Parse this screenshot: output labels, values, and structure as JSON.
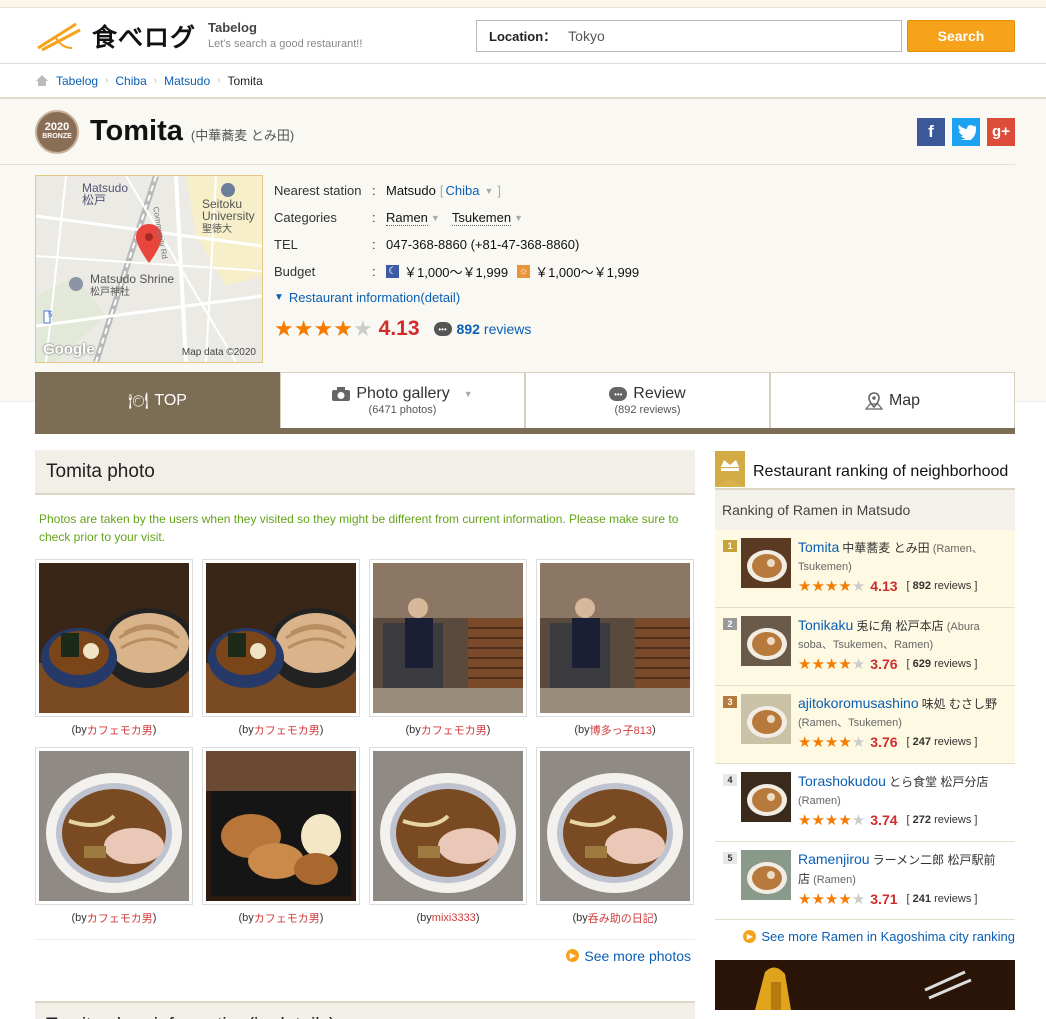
{
  "header": {
    "logo_text": "食べログ",
    "logo_title": "Tabelog",
    "logo_tagline": "Let's search a good restaurant!!",
    "location_label": "Location：",
    "location_value": "Tokyo",
    "search_button": "Search"
  },
  "breadcrumb": [
    "Tabelog",
    "Chiba",
    "Matsudo",
    "Tomita"
  ],
  "restaurant": {
    "award_year": "2020",
    "award_level": "BRONZE",
    "name": "Tomita",
    "name_jp": "(中華蕎麦 とみ田)",
    "map": {
      "label_station_en": "Matsudo",
      "label_station_jp": "松戸",
      "label_univ_en": "Seitoku University",
      "label_univ_jp": "聖徳大",
      "label_shrine_en": "Matsudo Shrine",
      "label_shrine_jp": "松戸神社",
      "label_road": "Community Rd",
      "label_route": "5",
      "google": "Google",
      "mapdata": "Map data ©2020"
    },
    "facts": {
      "station_key": "Nearest station",
      "station_value": "Matsudo",
      "station_area": "Chiba",
      "categories_key": "Categories",
      "category_1": "Ramen",
      "category_2": "Tsukemen",
      "tel_key": "TEL",
      "tel_value": "047-368-8860 (+81-47-368-8860)",
      "budget_key": "Budget",
      "budget_dinner": "￥1,000～￥1,999",
      "budget_lunch": "￥1,000～￥1,999"
    },
    "detail_link": "Restaurant information(detail)",
    "rating": 4.13,
    "rating_text": "4.13",
    "reviews_count": "892",
    "reviews_label": "reviews"
  },
  "tabs": [
    {
      "label": "TOP",
      "sub": ""
    },
    {
      "label": "Photo gallery",
      "sub": "(6471 photos)"
    },
    {
      "label": "Review",
      "sub": "(892 reviews)"
    },
    {
      "label": "Map",
      "sub": ""
    }
  ],
  "photos": {
    "title": "Tomita photo",
    "note": "Photos are taken by the users when they visited so they might be different from current information. Please make sure to check prior to your visit.",
    "by_prefix": "(by ",
    "by_suffix": ")",
    "items": [
      {
        "author": "カフェモカ男",
        "subject": "tsukemen-noodles"
      },
      {
        "author": "カフェモカ男",
        "subject": "tsukemen-noodles"
      },
      {
        "author": "カフェモカ男",
        "subject": "kitchen"
      },
      {
        "author": "博多っ子813",
        "subject": "kitchen"
      },
      {
        "author": "カフェモカ男",
        "subject": "ramen-bowl"
      },
      {
        "author": "カフェモカ男",
        "subject": "chashu-egg"
      },
      {
        "author": "mixi3333",
        "subject": "ramen-bowl"
      },
      {
        "author": "呑み助の日記",
        "subject": "ramen-bowl"
      }
    ],
    "see_more": "See more photos"
  },
  "shop_info_title": "Tomita shop information(in details)",
  "ranking": {
    "title": "Restaurant ranking of neighborhood",
    "subtitle": "Ranking of Ramen in Matsudo",
    "items": [
      {
        "rank": "1",
        "name": "Tomita",
        "jp": "中華蕎麦 とみ田",
        "cats": "(Ramen、Tsukemen)",
        "rating": 4.13,
        "score": "4.13",
        "reviews": "892"
      },
      {
        "rank": "2",
        "name": "Tonikaku",
        "jp": "兎に角 松戸本店",
        "cats": "(Abura soba、Tsukemen、Ramen)",
        "rating": 3.76,
        "score": "3.76",
        "reviews": "629"
      },
      {
        "rank": "3",
        "name": "ajitokoromusashino",
        "jp": "味処 むさし野",
        "cats": "(Ramen、Tsukemen)",
        "rating": 3.76,
        "score": "3.76",
        "reviews": "247"
      },
      {
        "rank": "4",
        "name": "Torashokudou",
        "jp": "とら食堂 松戸分店",
        "cats": "(Ramen)",
        "rating": 3.74,
        "score": "3.74",
        "reviews": "272"
      },
      {
        "rank": "5",
        "name": "Ramenjirou",
        "jp": "ラーメン二郎 松戸駅前店",
        "cats": "(Ramen)",
        "rating": 3.71,
        "score": "3.71",
        "reviews": "241"
      }
    ],
    "reviews_word": "reviews",
    "see_more": "See more Ramen in Kagoshima city ranking"
  },
  "colors": {
    "accent": "#f7a21b",
    "tab_active": "#7b6e54",
    "score": "#d12b2b",
    "link": "#0a5fb4",
    "note": "#64a41a"
  }
}
